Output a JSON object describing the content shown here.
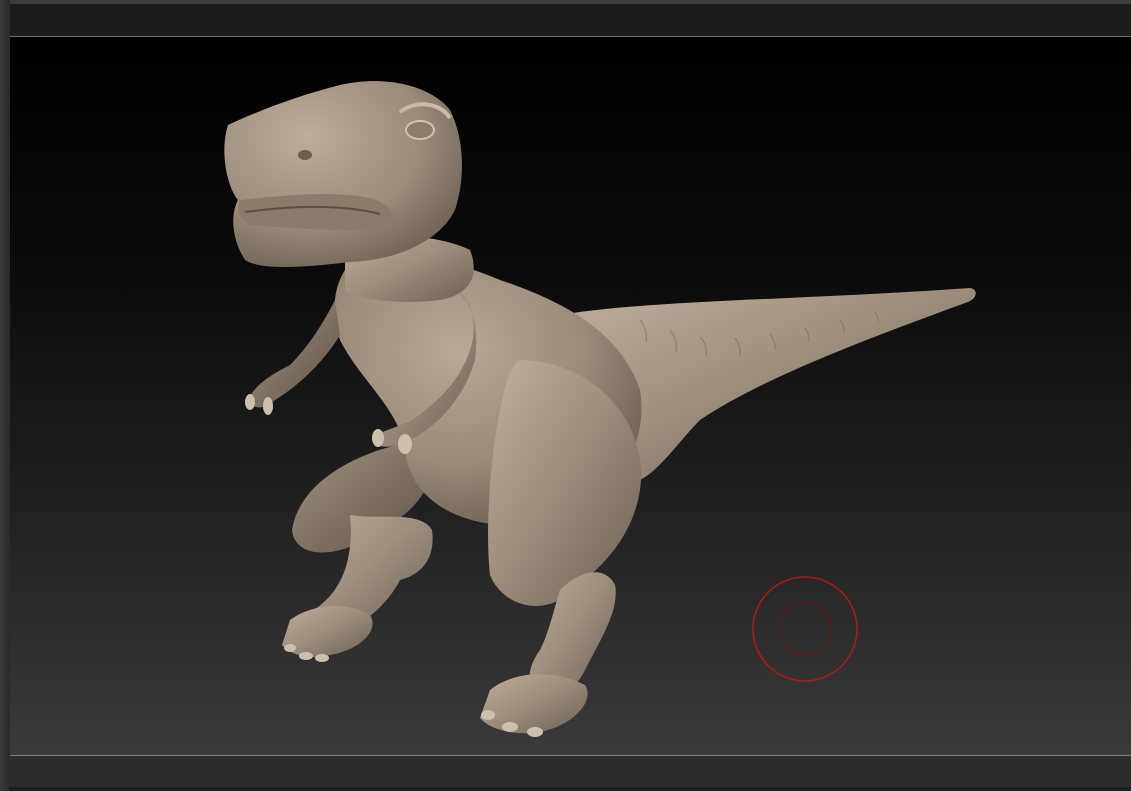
{
  "viewport": {
    "background_top": "#000000",
    "background_bottom": "#3a3a3a",
    "model": {
      "name": "t-rex-sculpt",
      "material_color": "#9e8f7f",
      "highlight_color": "#cbbcab",
      "shadow_color": "#5e5247"
    },
    "brush_cursor": {
      "icon": "brush-cursor-icon",
      "color": "#b01a1a"
    }
  }
}
